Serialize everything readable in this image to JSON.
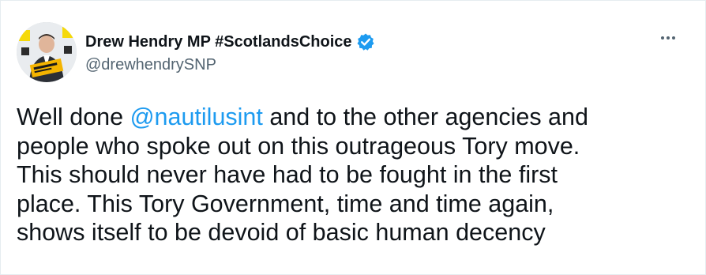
{
  "tweet": {
    "author": {
      "display_name": "Drew Hendry MP #ScotlandsChoice",
      "handle": "@drewhendrySNP",
      "verified": true
    },
    "more_icon": "more-horizontal-icon",
    "text": {
      "prefix": "Well done ",
      "mention": "@nautilusint",
      "line1_rest": " and to the other agencies and",
      "line2": "people who spoke out on this outrageous Tory move.",
      "line3": "This should never have had to be fought in the first",
      "line4": "place. This Tory Government, time and time again,",
      "line5": "shows itself to be devoid of basic human decency"
    }
  },
  "colors": {
    "accent": "#1d9bf0",
    "secondary_text": "#536471",
    "primary_text": "#0f1419",
    "verified_badge": "#1d9bf0"
  }
}
